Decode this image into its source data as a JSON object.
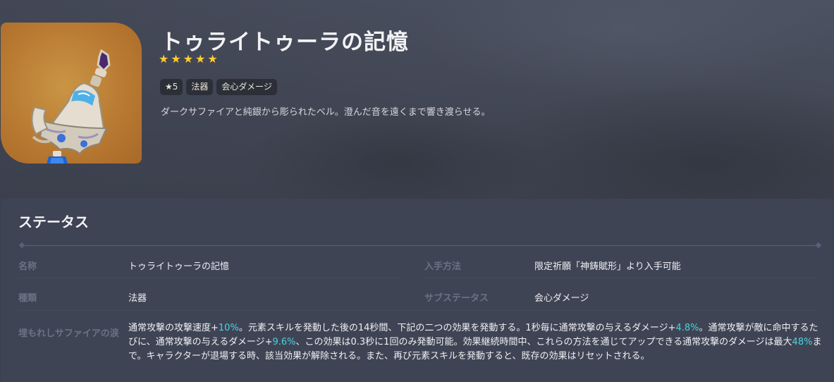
{
  "weapon": {
    "name": "トゥライトゥーラの記憶",
    "rarity_stars": 5,
    "tags": [
      "★5",
      "法器",
      "会心ダメージ"
    ],
    "description": "ダークサファイアと純銀から彫られたベル。澄んだ音を遠くまで響き渡らせる。"
  },
  "status": {
    "title": "ステータス",
    "fields": {
      "name_label": "名称",
      "name_value": "トゥライトゥーラの記憶",
      "acquire_label": "入手方法",
      "acquire_value": "限定祈願「神鋳賦形」より入手可能",
      "type_label": "種類",
      "type_value": "法器",
      "substat_label": "サブステータス",
      "substat_value": "会心ダメージ"
    },
    "passive": {
      "label": "埋もれしサファイアの涙",
      "segments": [
        {
          "text": "通常攻撃の攻撃速度+",
          "highlight": false
        },
        {
          "text": "10%",
          "highlight": true
        },
        {
          "text": "。元素スキルを発動した後の14秒間、下記の二つの効果を発動する。1秒毎に通常攻撃の与えるダメージ+",
          "highlight": false
        },
        {
          "text": "4.8%",
          "highlight": true
        },
        {
          "text": "。通常攻撃が敵に命中するたびに、通常攻撃の与えるダメージ+",
          "highlight": false
        },
        {
          "text": "9.6%",
          "highlight": true
        },
        {
          "text": "、この効果は0.3秒に1回のみ発動可能。効果継続時間中、これらの方法を通じてアップできる通常攻撃のダメージは最大",
          "highlight": false
        },
        {
          "text": "48%",
          "highlight": true
        },
        {
          "text": "まで。キャラクターが退場する時、該当効果が解除される。また、再び元素スキルを発動すると、既存の効果はリセットされる。",
          "highlight": false
        }
      ]
    }
  },
  "colors": {
    "star": "#ffcc33",
    "highlight": "#4ad3e0",
    "icon_background": "#b97a32"
  },
  "icons": {
    "weapon_image": "bell-catalyst-icon",
    "star": "star-icon"
  }
}
